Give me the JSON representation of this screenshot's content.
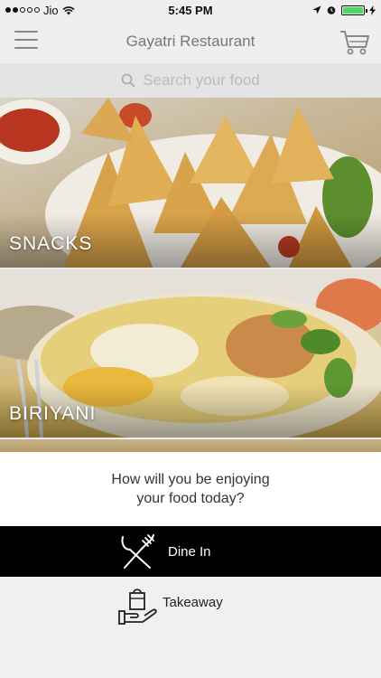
{
  "status_bar": {
    "carrier": "Jio",
    "time": "5:45 PM",
    "battery_color": "#4cd964"
  },
  "header": {
    "title": "Gayatri Restaurant",
    "menu_icon": "hamburger-menu-icon",
    "cart_icon": "shopping-cart-icon"
  },
  "search": {
    "placeholder": "Search your food",
    "icon": "search-icon"
  },
  "categories": [
    {
      "label": "SNACKS"
    },
    {
      "label": "BIRIYANI"
    }
  ],
  "order_prompt": {
    "line1": "How will you be enjoying",
    "line2": "your food today?",
    "options": [
      {
        "label": "Dine In",
        "icon": "fork-knife-icon",
        "selected": true
      },
      {
        "label": "Takeaway",
        "icon": "takeaway-bag-icon",
        "selected": false
      }
    ]
  }
}
